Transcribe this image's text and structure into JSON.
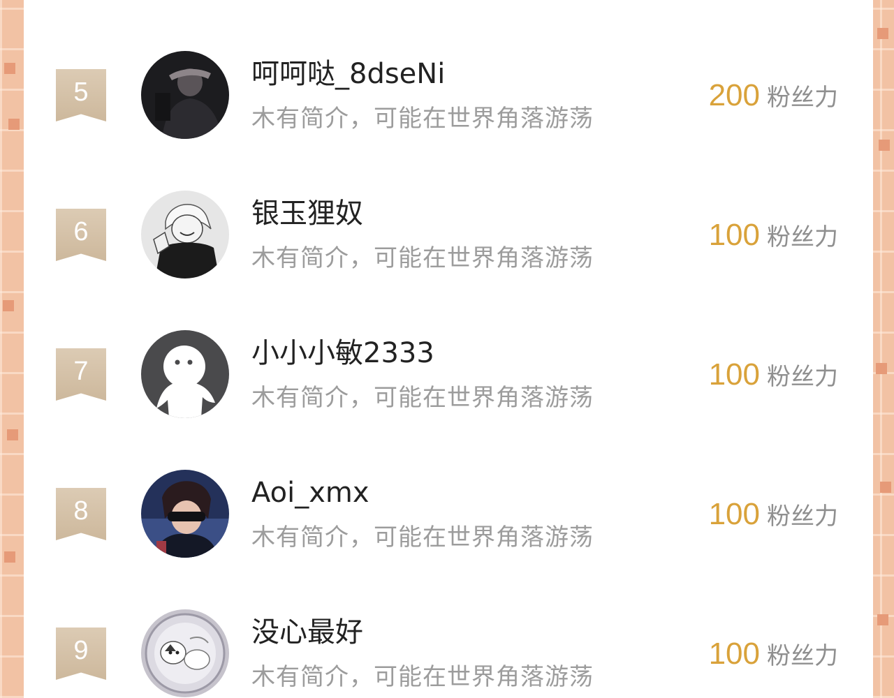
{
  "ranking": {
    "rows": [
      {
        "rank": "5",
        "name": "呵呵哒_8dseNi",
        "bio": "木有简介，可能在世界角落游荡",
        "score": "200",
        "unit": "粉丝力",
        "avatar": "avatar-dark-photo"
      },
      {
        "rank": "6",
        "name": "银玉狸奴",
        "bio": "木有简介，可能在世界角落游荡",
        "score": "100",
        "unit": "粉丝力",
        "avatar": "avatar-anime-mono"
      },
      {
        "rank": "7",
        "name": "小小小敏2333",
        "bio": "木有简介，可能在世界角落游荡",
        "score": "100",
        "unit": "粉丝力",
        "avatar": "avatar-default"
      },
      {
        "rank": "8",
        "name": "Aoi_xmx",
        "bio": "木有简介，可能在世界角落游荡",
        "score": "100",
        "unit": "粉丝力",
        "avatar": "avatar-anime-color"
      },
      {
        "rank": "9",
        "name": "没心最好",
        "bio": "木有简介，可能在世界角落游荡",
        "score": "100",
        "unit": "粉丝力",
        "avatar": "avatar-illustration"
      }
    ]
  },
  "colors": {
    "score": "#d9a23a",
    "rank_badge": "#cdb89c",
    "background": "#f2c2a4",
    "name": "#222222",
    "bio": "#9c9c9c"
  }
}
